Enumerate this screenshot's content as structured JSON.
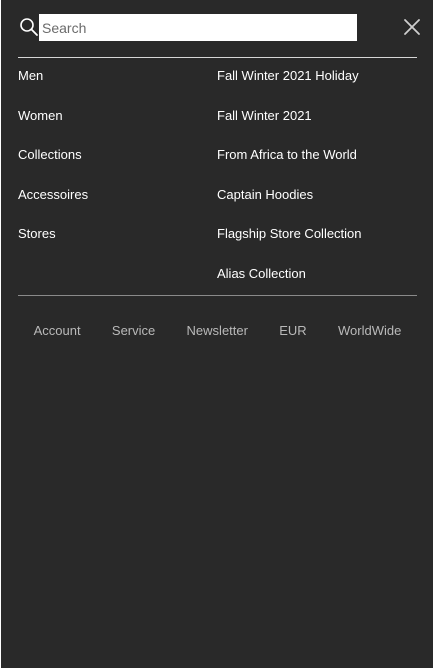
{
  "search": {
    "placeholder": "Search",
    "icon": "search-icon"
  },
  "close": {
    "icon": "close-icon"
  },
  "menu": {
    "left": [
      "Men",
      "Women",
      "Collections",
      "Accessoires",
      "Stores"
    ],
    "right": [
      "Fall Winter 2021 Holiday",
      "Fall Winter 2021",
      "From Africa to the World",
      "Captain Hoodies",
      "Flagship Store Collection",
      "Alias Collection"
    ]
  },
  "footer": [
    "Account",
    "Service",
    "Newsletter",
    "EUR",
    "WorldWide"
  ],
  "colors": {
    "background": "#292929",
    "text": "#ffffff",
    "footer_text": "#b9b9b9"
  }
}
